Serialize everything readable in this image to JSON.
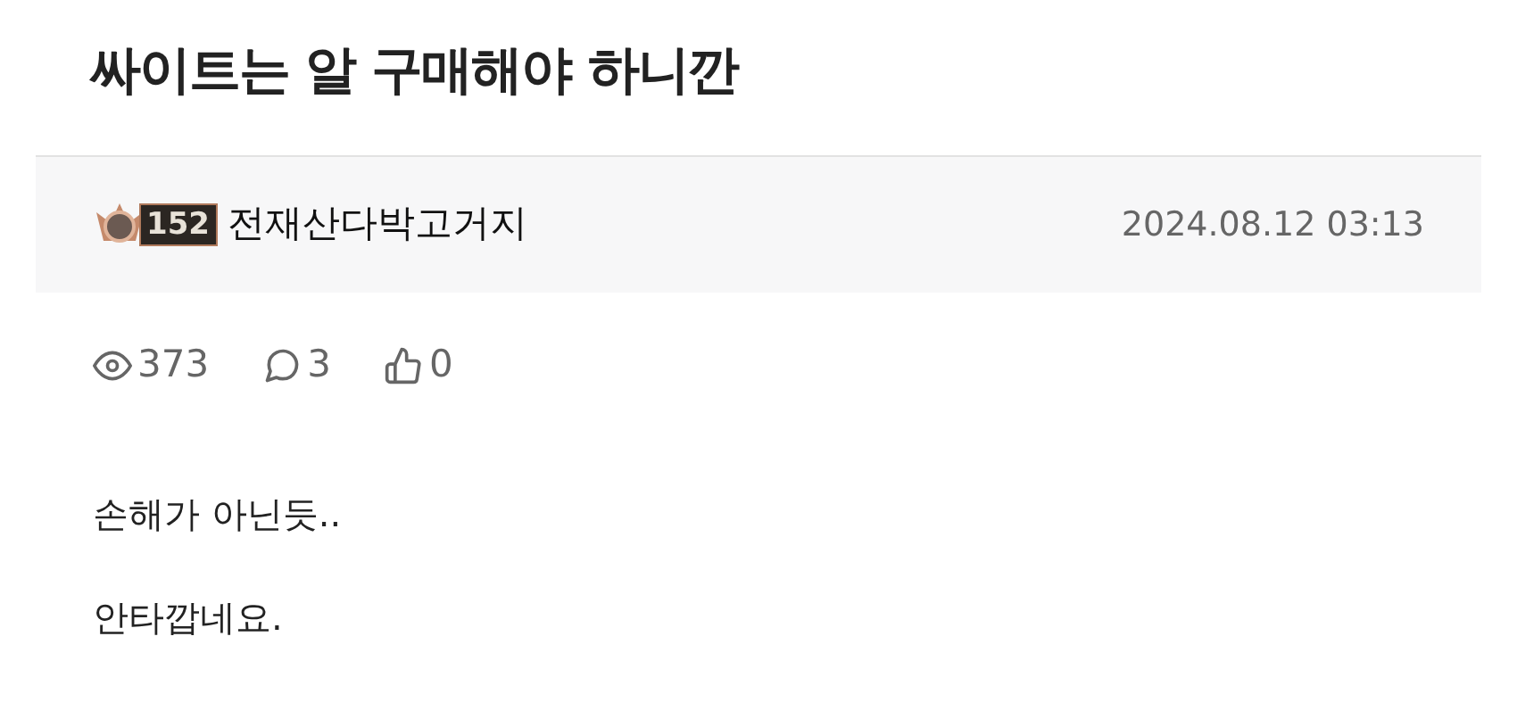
{
  "title": "싸이트는 알 구매해야 하니깐",
  "author": {
    "level": "152",
    "name": "전재산다박고거지"
  },
  "date": "2024.08.12 03:13",
  "stats": [
    {
      "kind": "views",
      "value": "373"
    },
    {
      "kind": "comments",
      "value": "3"
    },
    {
      "kind": "likes",
      "value": "0"
    }
  ],
  "body": [
    "손해가 아닌듯..",
    "안타깝네요."
  ]
}
